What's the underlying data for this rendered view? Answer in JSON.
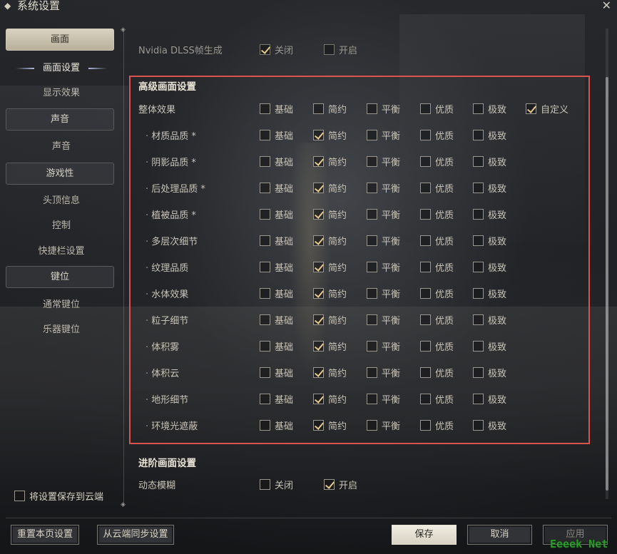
{
  "window": {
    "title": "系统设置"
  },
  "sidebar": {
    "groups": [
      {
        "label": "画面",
        "active": true,
        "items": [
          {
            "label": "画面设置",
            "active": true
          },
          {
            "label": "显示效果"
          }
        ]
      },
      {
        "label": "声音",
        "items": [
          {
            "label": "声音"
          }
        ]
      },
      {
        "label": "游戏性",
        "items": [
          {
            "label": "头顶信息"
          },
          {
            "label": "控制"
          },
          {
            "label": "快捷栏设置"
          }
        ]
      },
      {
        "label": "键位",
        "items": [
          {
            "label": "通常键位"
          },
          {
            "label": "乐器键位"
          }
        ]
      }
    ],
    "cloud_save": {
      "label": "将设置保存到云端",
      "checked": false
    }
  },
  "dlss": {
    "label": "Nvidia DLSS帧生成",
    "options": [
      {
        "label": "关闭",
        "checked": true
      },
      {
        "label": "开启",
        "checked": false
      }
    ]
  },
  "advanced": {
    "title": "高级画面设置",
    "overall": {
      "label": "整体效果",
      "options": [
        "基础",
        "简约",
        "平衡",
        "优质",
        "极致",
        "自定义"
      ],
      "selected": "自定义"
    },
    "option_labels": [
      "基础",
      "简约",
      "平衡",
      "优质",
      "极致"
    ],
    "rows": [
      {
        "label": "材质品质 *",
        "selected": "简约"
      },
      {
        "label": "阴影品质 *",
        "selected": "简约"
      },
      {
        "label": "后处理品质 *",
        "selected": "简约"
      },
      {
        "label": "植被品质 *",
        "selected": "简约"
      },
      {
        "label": "多层次细节",
        "selected": "简约"
      },
      {
        "label": "纹理品质",
        "selected": "简约"
      },
      {
        "label": "水体效果",
        "selected": "简约"
      },
      {
        "label": "粒子细节",
        "selected": "简约"
      },
      {
        "label": "体积雾",
        "selected": "简约"
      },
      {
        "label": "体积云",
        "selected": "简约"
      },
      {
        "label": "地形细节",
        "selected": "简约"
      },
      {
        "label": "环境光遮蔽",
        "selected": "简约"
      }
    ]
  },
  "pro": {
    "title": "进阶画面设置",
    "motion_blur": {
      "label": "动态模糊",
      "options": [
        {
          "label": "关闭",
          "checked": false
        },
        {
          "label": "开启",
          "checked": true
        }
      ]
    }
  },
  "footer": {
    "reset_label": "重置本页设置",
    "sync_label": "从云端同步设置",
    "save_label": "保存",
    "cancel_label": "取消",
    "apply_label": "应用"
  },
  "watermark": "Eeeek Net",
  "colors": {
    "highlight": "#d9534f",
    "check": "#e6c98c",
    "active_tab": "#d9d2c0"
  }
}
